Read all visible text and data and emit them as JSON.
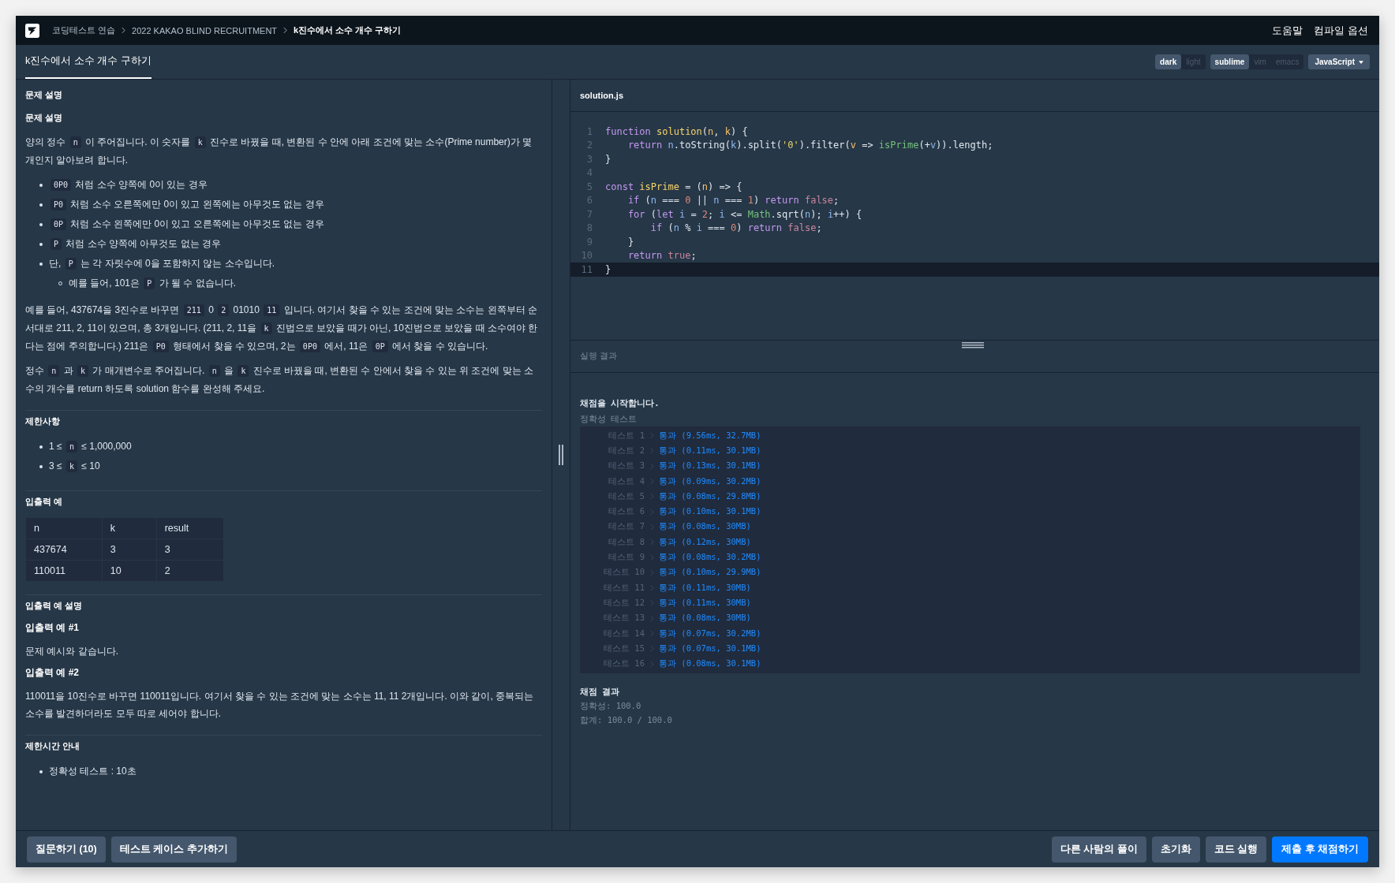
{
  "header": {
    "breadcrumbs": [
      {
        "label": "코딩테스트 연습",
        "current": false
      },
      {
        "label": "2022 KAKAO BLIND RECRUITMENT",
        "current": false
      },
      {
        "label": "k진수에서 소수 개수 구하기",
        "current": true
      }
    ],
    "links": [
      "도움말",
      "컴파일 옵션"
    ]
  },
  "tabs": [
    {
      "label": "k진수에서 소수 개수 구하기",
      "selected": true
    }
  ],
  "editor_options": {
    "themes": [
      {
        "label": "dark",
        "selected": true
      },
      {
        "label": "light",
        "selected": false
      }
    ],
    "keymaps": [
      {
        "label": "sublime",
        "selected": true
      },
      {
        "label": "vim",
        "selected": false
      },
      {
        "label": "emacs",
        "selected": false
      }
    ],
    "language": "JavaScript"
  },
  "problem": {
    "title": "문제 설명",
    "sections": [
      {
        "heading": "문제 설명",
        "blocks": [
          {
            "kind": "paragraph",
            "segments": [
              {
                "text": "양의 정수 "
              },
              {
                "text": "n",
                "code": true
              },
              {
                "text": " 이 주어집니다. 이 숫자를 "
              },
              {
                "text": "k",
                "code": true
              },
              {
                "text": " 진수로 바꿨을 때, 변환된 수 안에 아래 조건에 맞는 소수(Prime number)가 몇 개인지 알아보려 합니다."
              }
            ]
          },
          {
            "kind": "list",
            "items": [
              {
                "segments": [
                  {
                    "text": "0P0",
                    "code": true
                  },
                  {
                    "text": " 처럼 소수 양쪽에 0이 있는 경우"
                  }
                ]
              },
              {
                "segments": [
                  {
                    "text": "P0",
                    "code": true
                  },
                  {
                    "text": " 처럼 소수 오른쪽에만 0이 있고 왼쪽에는 아무것도 없는 경우"
                  }
                ]
              },
              {
                "segments": [
                  {
                    "text": "0P",
                    "code": true
                  },
                  {
                    "text": " 처럼 소수 왼쪽에만 0이 있고 오른쪽에는 아무것도 없는 경우"
                  }
                ]
              },
              {
                "segments": [
                  {
                    "text": "P",
                    "code": true
                  },
                  {
                    "text": " 처럼 소수 양쪽에 아무것도 없는 경우"
                  }
                ]
              },
              {
                "segments": [
                  {
                    "text": "단, "
                  },
                  {
                    "text": "P",
                    "code": true
                  },
                  {
                    "text": " 는 각 자릿수에 0을 포함하지 않는 소수입니다."
                  }
                ],
                "children": [
                  {
                    "segments": [
                      {
                        "text": "예를 들어, 101은 "
                      },
                      {
                        "text": "P",
                        "code": true
                      },
                      {
                        "text": " 가 될 수 없습니다."
                      }
                    ]
                  }
                ]
              }
            ]
          },
          {
            "kind": "paragraph",
            "segments": [
              {
                "text": "예를 들어, 437674을 3진수로 바꾸면 "
              },
              {
                "text": "211",
                "code": true
              },
              {
                "text": " 0 "
              },
              {
                "text": "2",
                "code": true
              },
              {
                "text": " 01010 "
              },
              {
                "text": "11",
                "code": true
              },
              {
                "text": " 입니다. 여기서 찾을 수 있는 조건에 맞는 소수는 왼쪽부터 순서대로 211, 2, 11이 있으며, 총 3개입니다. (211, 2, 11을 "
              },
              {
                "text": "k",
                "code": true
              },
              {
                "text": " 진법으로 보았을 때가 아닌, 10진법으로 보았을 때 소수여야 한다는 점에 주의합니다.) 211은 "
              },
              {
                "text": "P0",
                "code": true
              },
              {
                "text": " 형태에서 찾을 수 있으며, 2는 "
              },
              {
                "text": "0P0",
                "code": true
              },
              {
                "text": " 에서, 11은 "
              },
              {
                "text": "0P",
                "code": true
              },
              {
                "text": " 에서 찾을 수 있습니다."
              }
            ]
          },
          {
            "kind": "paragraph",
            "segments": [
              {
                "text": "정수 "
              },
              {
                "text": "n",
                "code": true
              },
              {
                "text": " 과 "
              },
              {
                "text": "k",
                "code": true
              },
              {
                "text": " 가 매개변수로 주어집니다. "
              },
              {
                "text": "n",
                "code": true
              },
              {
                "text": " 을 "
              },
              {
                "text": "k",
                "code": true
              },
              {
                "text": " 진수로 바꿨을 때, 변환된 수 안에서 찾을 수 있는 위 조건에 맞는 소수의 개수를 return 하도록 solution 함수를 완성해 주세요."
              }
            ]
          }
        ]
      },
      {
        "heading": "제한사항",
        "blocks": [
          {
            "kind": "list",
            "items": [
              {
                "segments": [
                  {
                    "text": "1 ≤ "
                  },
                  {
                    "text": "n",
                    "code": true
                  },
                  {
                    "text": " ≤ 1,000,000"
                  }
                ]
              },
              {
                "segments": [
                  {
                    "text": "3 ≤ "
                  },
                  {
                    "text": "k",
                    "code": true
                  },
                  {
                    "text": " ≤ 10"
                  }
                ]
              }
            ]
          }
        ]
      },
      {
        "heading": "입출력 예",
        "blocks": [
          {
            "kind": "table",
            "columns": [
              "n",
              "k",
              "result"
            ],
            "rows": [
              [
                "437674",
                "3",
                "3"
              ],
              [
                "110011",
                "10",
                "2"
              ]
            ]
          }
        ]
      },
      {
        "heading": "입출력 예 설명",
        "blocks": [
          {
            "kind": "subheading",
            "text": "입출력 예 #1"
          },
          {
            "kind": "paragraph",
            "segments": [
              {
                "text": "문제 예시와 같습니다."
              }
            ]
          },
          {
            "kind": "subheading",
            "text": "입출력 예 #2"
          },
          {
            "kind": "paragraph",
            "segments": [
              {
                "text": "110011을 10진수로 바꾸면 110011입니다. 여기서 찾을 수 있는 조건에 맞는 소수는 11, 11 2개입니다. 이와 같이, 중복되는 소수를 발견하더라도 모두 따로 세어야 합니다."
              }
            ]
          }
        ]
      },
      {
        "heading": "제한시간 안내",
        "blocks": [
          {
            "kind": "list",
            "items": [
              {
                "segments": [
                  {
                    "text": "정확성 테스트 : 10초"
                  }
                ]
              }
            ]
          }
        ]
      }
    ]
  },
  "editor": {
    "filename": "solution.js",
    "lines": [
      {
        "number": "1",
        "current": false,
        "tokens": [
          {
            "kind": "keyword",
            "text": "function"
          },
          {
            "kind": "function",
            "text": " solution"
          },
          {
            "kind": "plain",
            "text": "("
          },
          {
            "kind": "param",
            "text": "n"
          },
          {
            "kind": "plain",
            "text": ", "
          },
          {
            "kind": "param",
            "text": "k"
          },
          {
            "kind": "plain",
            "text": ") {"
          }
        ]
      },
      {
        "number": "2",
        "current": false,
        "tokens": [
          {
            "kind": "keyword",
            "text": "    return"
          },
          {
            "kind": "variable",
            "text": " n"
          },
          {
            "kind": "plain",
            "text": ".toString("
          },
          {
            "kind": "variable",
            "text": "k"
          },
          {
            "kind": "plain",
            "text": ").split("
          },
          {
            "kind": "string",
            "text": "'0'"
          },
          {
            "kind": "plain",
            "text": ").filter("
          },
          {
            "kind": "param",
            "text": "v"
          },
          {
            "kind": "plain",
            "text": " => "
          },
          {
            "kind": "call",
            "text": "isPrime"
          },
          {
            "kind": "plain",
            "text": "(+"
          },
          {
            "kind": "variable",
            "text": "v"
          },
          {
            "kind": "plain",
            "text": ")).length;"
          }
        ]
      },
      {
        "number": "3",
        "current": false,
        "tokens": [
          {
            "kind": "plain",
            "text": "}"
          }
        ]
      },
      {
        "number": "4",
        "current": false
      },
      {
        "number": "5",
        "current": false,
        "tokens": [
          {
            "kind": "keyword",
            "text": "const"
          },
          {
            "kind": "function",
            "text": " isPrime"
          },
          {
            "kind": "plain",
            "text": " = ("
          },
          {
            "kind": "param",
            "text": "n"
          },
          {
            "kind": "plain",
            "text": ") => {"
          }
        ]
      },
      {
        "number": "6",
        "current": false,
        "tokens": [
          {
            "kind": "keyword",
            "text": "    if"
          },
          {
            "kind": "plain",
            "text": " ("
          },
          {
            "kind": "variable",
            "text": "n"
          },
          {
            "kind": "plain",
            "text": " === "
          },
          {
            "kind": "number",
            "text": "0"
          },
          {
            "kind": "plain",
            "text": " || "
          },
          {
            "kind": "variable",
            "text": "n"
          },
          {
            "kind": "plain",
            "text": " === "
          },
          {
            "kind": "number",
            "text": "1"
          },
          {
            "kind": "plain",
            "text": ") "
          },
          {
            "kind": "keyword",
            "text": "return"
          },
          {
            "kind": "boolean",
            "text": " false"
          },
          {
            "kind": "plain",
            "text": ";"
          }
        ]
      },
      {
        "number": "7",
        "current": false,
        "tokens": [
          {
            "kind": "keyword",
            "text": "    for"
          },
          {
            "kind": "plain",
            "text": " ("
          },
          {
            "kind": "keyword",
            "text": "let"
          },
          {
            "kind": "variable",
            "text": " i"
          },
          {
            "kind": "plain",
            "text": " = "
          },
          {
            "kind": "number",
            "text": "2"
          },
          {
            "kind": "plain",
            "text": "; "
          },
          {
            "kind": "variable",
            "text": "i"
          },
          {
            "kind": "plain",
            "text": " <= "
          },
          {
            "kind": "call",
            "text": "Math"
          },
          {
            "kind": "plain",
            "text": ".sqrt("
          },
          {
            "kind": "variable",
            "text": "n"
          },
          {
            "kind": "plain",
            "text": "); "
          },
          {
            "kind": "variable",
            "text": "i"
          },
          {
            "kind": "plain",
            "text": "++) {"
          }
        ]
      },
      {
        "number": "8",
        "current": false,
        "tokens": [
          {
            "kind": "keyword",
            "text": "        if"
          },
          {
            "kind": "plain",
            "text": " ("
          },
          {
            "kind": "variable",
            "text": "n"
          },
          {
            "kind": "plain",
            "text": " % "
          },
          {
            "kind": "variable",
            "text": "i"
          },
          {
            "kind": "plain",
            "text": " === "
          },
          {
            "kind": "number",
            "text": "0"
          },
          {
            "kind": "plain",
            "text": ") "
          },
          {
            "kind": "keyword",
            "text": "return"
          },
          {
            "kind": "boolean",
            "text": " false"
          },
          {
            "kind": "plain",
            "text": ";"
          }
        ]
      },
      {
        "number": "9",
        "current": false,
        "tokens": [
          {
            "kind": "plain",
            "text": "    }"
          }
        ]
      },
      {
        "number": "10",
        "current": false,
        "tokens": [
          {
            "kind": "keyword",
            "text": "    return"
          },
          {
            "kind": "boolean",
            "text": " true"
          },
          {
            "kind": "plain",
            "text": ";"
          }
        ]
      },
      {
        "number": "11",
        "current": true,
        "tokens": [
          {
            "kind": "plain",
            "text": "}"
          }
        ]
      }
    ]
  },
  "results": {
    "title": "실행 결과",
    "start": "채점을 시작합니다.",
    "group": "정확성  테스트",
    "tests": [
      {
        "label": "테스트 1",
        "result": "통과 (9.56ms, 32.7MB)"
      },
      {
        "label": "테스트 2",
        "result": "통과 (0.11ms, 30.1MB)"
      },
      {
        "label": "테스트 3",
        "result": "통과 (0.13ms, 30.1MB)"
      },
      {
        "label": "테스트 4",
        "result": "통과 (0.09ms, 30.2MB)"
      },
      {
        "label": "테스트 5",
        "result": "통과 (0.08ms, 29.8MB)"
      },
      {
        "label": "테스트 6",
        "result": "통과 (0.10ms, 30.1MB)"
      },
      {
        "label": "테스트 7",
        "result": "통과 (0.08ms, 30MB)"
      },
      {
        "label": "테스트 8",
        "result": "통과 (0.12ms, 30MB)"
      },
      {
        "label": "테스트 9",
        "result": "통과 (0.08ms, 30.2MB)"
      },
      {
        "label": "테스트 10",
        "result": "통과 (0.10ms, 29.9MB)"
      },
      {
        "label": "테스트 11",
        "result": "통과 (0.11ms, 30MB)"
      },
      {
        "label": "테스트 12",
        "result": "통과 (0.11ms, 30MB)"
      },
      {
        "label": "테스트 13",
        "result": "통과 (0.08ms, 30MB)"
      },
      {
        "label": "테스트 14",
        "result": "통과 (0.07ms, 30.2MB)"
      },
      {
        "label": "테스트 15",
        "result": "통과 (0.07ms, 30.1MB)"
      },
      {
        "label": "테스트 16",
        "result": "통과 (0.08ms, 30.1MB)"
      }
    ],
    "summary_title": "채점 결과",
    "summary": [
      "정확성: 100.0",
      "합계: 100.0 / 100.0"
    ]
  },
  "footer": {
    "left_buttons": [
      {
        "label": "질문하기 (10)",
        "kind": "secondary"
      },
      {
        "label": "테스트 케이스 추가하기",
        "kind": "secondary"
      }
    ],
    "right_buttons": [
      {
        "label": "다른 사람의 풀이",
        "kind": "secondary"
      },
      {
        "label": "초기화",
        "kind": "secondary"
      },
      {
        "label": "코드 실행",
        "kind": "secondary"
      },
      {
        "label": "제출 후 채점하기",
        "kind": "primary"
      }
    ]
  }
}
